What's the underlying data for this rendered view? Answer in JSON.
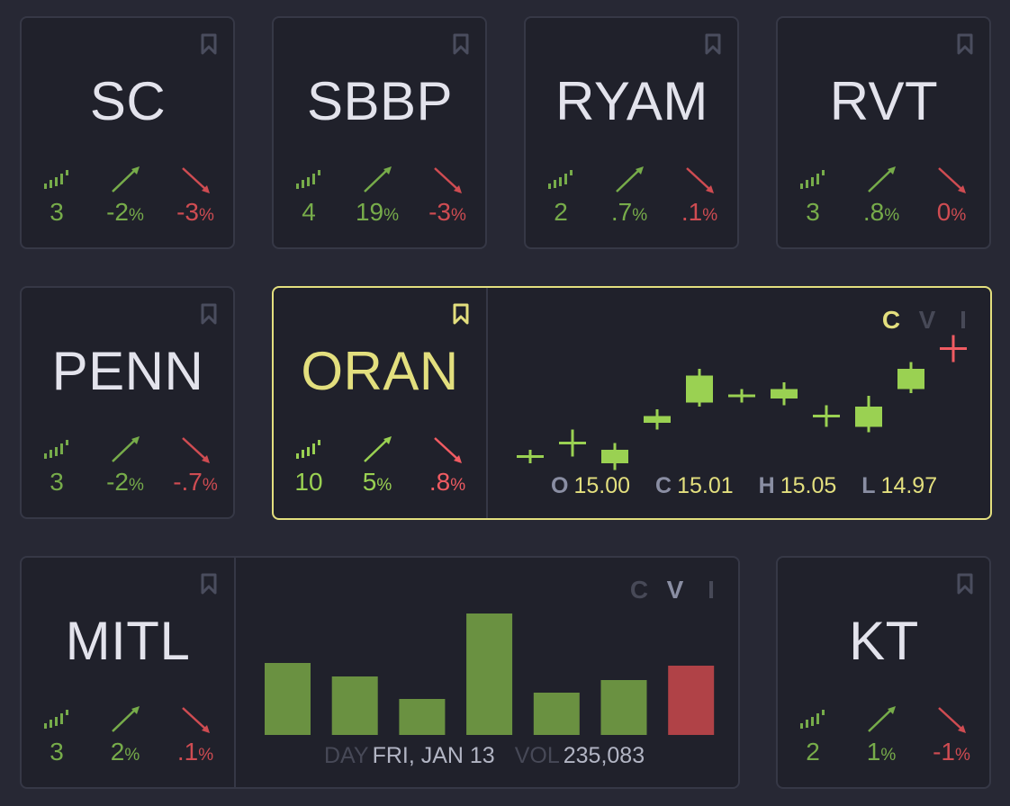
{
  "tiles": [
    {
      "symbol": "SC",
      "count": "3",
      "up_value": "-2",
      "down_value": "-3",
      "pct": "%"
    },
    {
      "symbol": "SBBP",
      "count": "4",
      "up_value": "19",
      "down_value": "-3",
      "pct": "%"
    },
    {
      "symbol": "RYAM",
      "count": "2",
      "up_value": ".7",
      "down_value": ".1",
      "pct": "%"
    },
    {
      "symbol": "RVT",
      "count": "3",
      "up_value": ".8",
      "down_value": "0",
      "pct": "%"
    },
    {
      "symbol": "PENN",
      "count": "3",
      "up_value": "-2",
      "down_value": "-.7",
      "pct": "%"
    },
    {
      "symbol": "ORAN",
      "count": "10",
      "up_value": "5",
      "down_value": ".8",
      "pct": "%"
    },
    {
      "symbol": "MITL",
      "count": "3",
      "up_value": "2",
      "down_value": ".1",
      "pct": "%"
    },
    {
      "symbol": "KT",
      "count": "2",
      "up_value": "1",
      "down_value": "-1",
      "pct": "%"
    }
  ],
  "icons": {
    "bookmark": "bookmark-icon",
    "bars": "signal-bars-icon",
    "up": "trend-up-arrow-icon",
    "down": "trend-down-arrow-icon"
  },
  "colors": {
    "background": "#272834",
    "card": "#20212b",
    "border": "#363846",
    "accent": "#e3df7e",
    "up": "#77ac4a",
    "down": "#cf4c52",
    "up_bright": "#9ad152",
    "down_bright": "#f05b62"
  },
  "chart_modes": {
    "candle": "C",
    "volume": "V",
    "info": "I"
  },
  "candle_panel": {
    "active_mode": "C",
    "ohlc": {
      "o_label": "O",
      "o_value": "15.00",
      "c_label": "C",
      "c_value": "15.01",
      "h_label": "H",
      "h_value": "15.05",
      "l_label": "L",
      "l_value": "14.97"
    }
  },
  "volume_panel": {
    "active_mode": "V",
    "day_label": "DAY",
    "day_value": "FRI, JAN 13",
    "vol_label": "VOL",
    "vol_value": "235,083"
  },
  "chart_data": [
    {
      "type": "candlestick",
      "title": "",
      "series": [
        {
          "open": 14.96,
          "close": 14.96,
          "high": 14.965,
          "low": 14.955,
          "direction": "up"
        },
        {
          "open": 14.97,
          "close": 14.97,
          "high": 14.98,
          "low": 14.96,
          "direction": "up"
        },
        {
          "open": 14.955,
          "close": 14.965,
          "high": 14.97,
          "low": 14.95,
          "direction": "up"
        },
        {
          "open": 14.985,
          "close": 14.99,
          "high": 14.995,
          "low": 14.98,
          "direction": "up"
        },
        {
          "open": 15.0,
          "close": 15.02,
          "high": 15.025,
          "low": 14.997,
          "direction": "up"
        },
        {
          "open": 15.005,
          "close": 15.005,
          "high": 15.01,
          "low": 15.0,
          "direction": "up"
        },
        {
          "open": 15.003,
          "close": 15.01,
          "high": 15.015,
          "low": 14.998,
          "direction": "up"
        },
        {
          "open": 14.99,
          "close": 14.99,
          "high": 14.998,
          "low": 14.982,
          "direction": "up"
        },
        {
          "open": 14.982,
          "close": 14.997,
          "high": 15.005,
          "low": 14.978,
          "direction": "up"
        },
        {
          "open": 15.01,
          "close": 15.025,
          "high": 15.03,
          "low": 15.007,
          "direction": "up"
        },
        {
          "open": 15.04,
          "close": 15.04,
          "high": 15.05,
          "low": 15.03,
          "direction": "down"
        }
      ],
      "ylim": [
        14.945,
        15.055
      ]
    },
    {
      "type": "bar",
      "title": "",
      "values": [
        80,
        65,
        40,
        135,
        47,
        61,
        77
      ],
      "colors": [
        "up",
        "up",
        "up",
        "up",
        "up",
        "up",
        "down"
      ],
      "ylim": [
        0,
        140
      ]
    }
  ]
}
